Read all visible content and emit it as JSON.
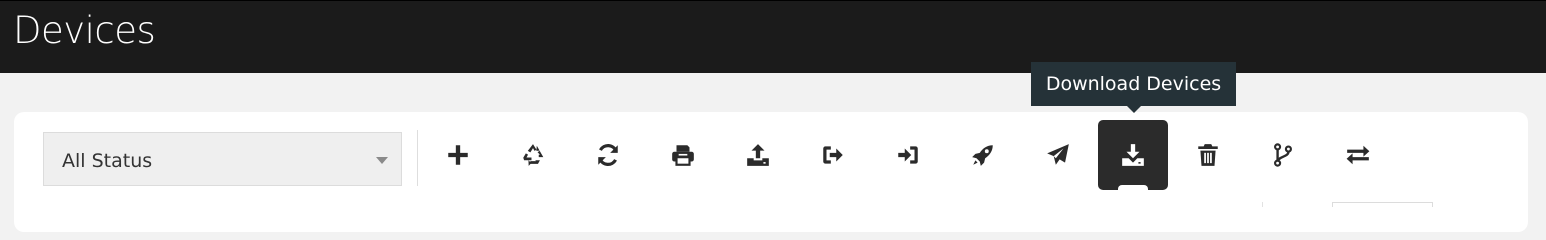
{
  "header": {
    "title": "Devices"
  },
  "filter": {
    "selected": "All Status"
  },
  "toolbar": {
    "buttons": [
      {
        "name": "add-button",
        "icon": "plus-icon"
      },
      {
        "name": "recycle-button",
        "icon": "recycle-icon"
      },
      {
        "name": "refresh-button",
        "icon": "refresh-icon"
      },
      {
        "name": "print-button",
        "icon": "print-icon"
      },
      {
        "name": "upload-button",
        "icon": "upload-icon"
      },
      {
        "name": "sign-out-button",
        "icon": "sign-out-icon"
      },
      {
        "name": "sign-in-button",
        "icon": "sign-in-icon"
      },
      {
        "name": "rocket-button",
        "icon": "rocket-icon"
      },
      {
        "name": "send-button",
        "icon": "paper-plane-icon"
      },
      {
        "name": "download-devices-button",
        "icon": "download-icon",
        "active": true
      },
      {
        "name": "delete-button",
        "icon": "trash-icon"
      },
      {
        "name": "branch-button",
        "icon": "code-branch-icon"
      },
      {
        "name": "transfer-button",
        "icon": "exchange-icon"
      }
    ],
    "tooltip": "Download Devices"
  },
  "colors": {
    "header_bg": "#1b1b1b",
    "tooltip_bg": "#253238",
    "active_button_bg": "#2b2b2b",
    "icon": "#2b2b2b"
  }
}
